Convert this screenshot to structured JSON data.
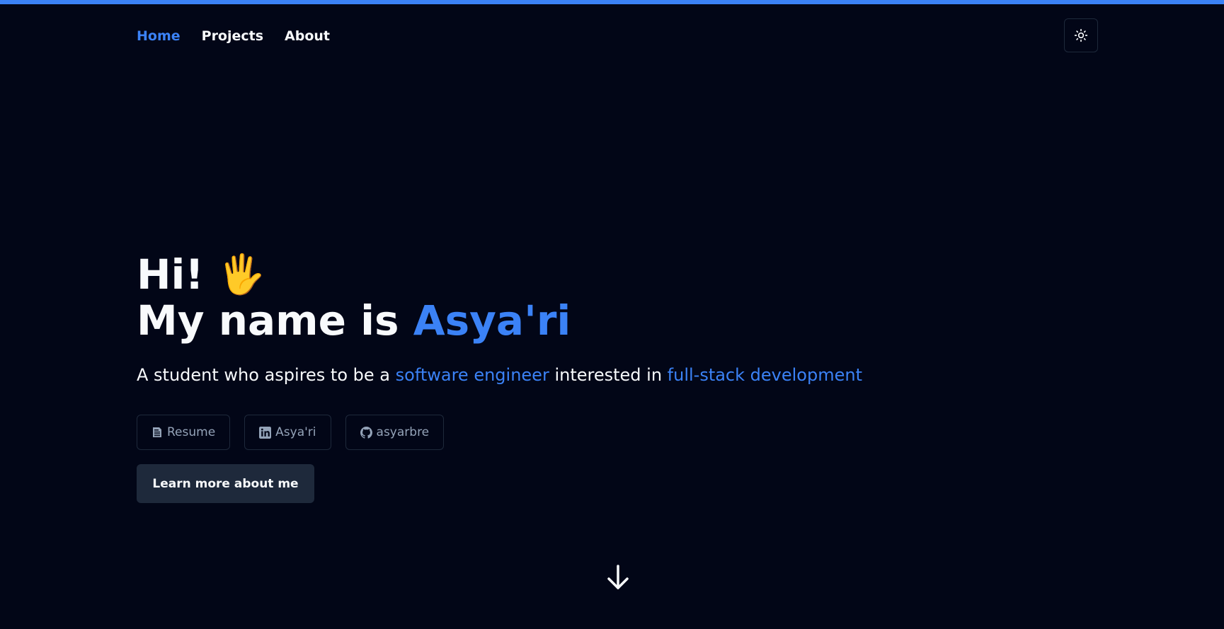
{
  "nav": {
    "items": [
      {
        "label": "Home",
        "active": true
      },
      {
        "label": "Projects",
        "active": false
      },
      {
        "label": "About",
        "active": false
      }
    ]
  },
  "theme_toggle": {
    "icon": "sun-icon"
  },
  "hero": {
    "greeting": "Hi!",
    "greeting_emoji": "🖐️",
    "name_prefix": "My name is ",
    "name": "Asya'ri",
    "tagline": {
      "part1": "A student who aspires to be a ",
      "highlight1": "software engineer",
      "part2": " interested in ",
      "highlight2": "full-stack development"
    }
  },
  "links": [
    {
      "label": "Resume",
      "icon": "document-icon"
    },
    {
      "label": "Asya'ri",
      "icon": "linkedin-icon"
    },
    {
      "label": "asyarbre",
      "icon": "github-icon"
    }
  ],
  "cta": {
    "label": "Learn more about me"
  },
  "scroll": {
    "icon": "arrow-down-icon"
  },
  "colors": {
    "background": "#020617",
    "accent": "#3b82f6",
    "text": "#f8fafc",
    "muted": "#94a3b8",
    "border": "#1e293b"
  }
}
